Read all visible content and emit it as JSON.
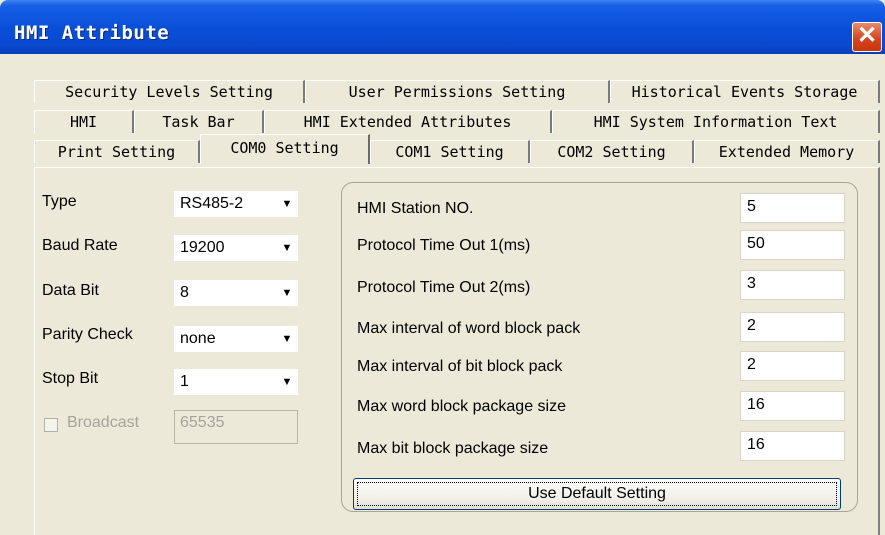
{
  "window": {
    "title": "HMI Attribute",
    "close_glyph": "✕"
  },
  "tabs": {
    "row1": [
      "Security Levels Setting",
      "User Permissions Setting",
      "Historical Events Storage"
    ],
    "row2": [
      "HMI",
      "Task Bar",
      "HMI Extended Attributes",
      "HMI System Information Text"
    ],
    "row3": [
      "Print Setting",
      "COM0 Setting",
      "COM1 Setting",
      "COM2 Setting",
      "Extended Memory"
    ],
    "active": "COM0 Setting"
  },
  "com_settings": {
    "type_label": "Type",
    "type_value": "RS485-2",
    "baud_label": "Baud Rate",
    "baud_value": "19200",
    "databit_label": "Data Bit",
    "databit_value": "8",
    "parity_label": "Parity Check",
    "parity_value": "none",
    "stopbit_label": "Stop Bit",
    "stopbit_value": "1",
    "broadcast_label": "Broadcast",
    "broadcast_checked": false,
    "broadcast_value": "65535"
  },
  "protocol": {
    "fields": [
      {
        "label": "HMI Station NO.",
        "value": "5"
      },
      {
        "label": "Protocol Time Out 1(ms)",
        "value": "50"
      },
      {
        "label": "Protocol Time Out 2(ms)",
        "value": "3"
      },
      {
        "label": "Max interval of word block pack",
        "value": "2"
      },
      {
        "label": "Max interval of bit block pack",
        "value": "2"
      },
      {
        "label": "Max word block package size",
        "value": "16"
      },
      {
        "label": "Max bit block package size",
        "value": "16"
      }
    ],
    "default_button": "Use Default Setting"
  },
  "icons": {
    "dropdown": "dropdown-arrow-icon",
    "close": "close-icon"
  }
}
